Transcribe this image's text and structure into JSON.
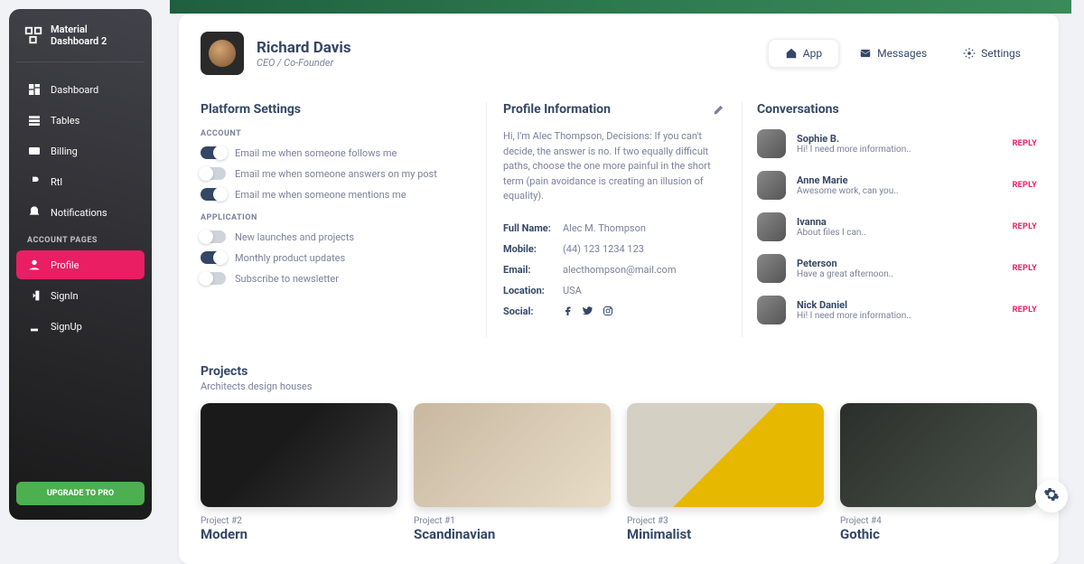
{
  "brand": "Material Dashboard 2",
  "nav": {
    "items": [
      {
        "label": "Dashboard",
        "icon": "dashboard-icon"
      },
      {
        "label": "Tables",
        "icon": "tables-icon"
      },
      {
        "label": "Billing",
        "icon": "billing-icon"
      },
      {
        "label": "Rtl",
        "icon": "rtl-icon"
      },
      {
        "label": "Notifications",
        "icon": "notifications-icon"
      }
    ],
    "section_label": "ACCOUNT PAGES",
    "account_items": [
      {
        "label": "Profile",
        "icon": "profile-icon",
        "active": true
      },
      {
        "label": "SignIn",
        "icon": "signin-icon"
      },
      {
        "label": "SignUp",
        "icon": "signup-icon"
      }
    ],
    "upgrade_label": "UPGRADE TO PRO"
  },
  "profile": {
    "name": "Richard Davis",
    "role": "CEO / Co-Founder"
  },
  "tabs": {
    "app": "App",
    "messages": "Messages",
    "settings": "Settings"
  },
  "settings": {
    "title": "Platform Settings",
    "account_label": "ACCOUNT",
    "account_toggles": [
      {
        "label": "Email me when someone follows me",
        "on": true
      },
      {
        "label": "Email me when someone answers on my post",
        "on": false
      },
      {
        "label": "Email me when someone mentions me",
        "on": true
      }
    ],
    "application_label": "APPLICATION",
    "app_toggles": [
      {
        "label": "New launches and projects",
        "on": false
      },
      {
        "label": "Monthly product updates",
        "on": true
      },
      {
        "label": "Subscribe to newsletter",
        "on": false
      }
    ]
  },
  "info": {
    "title": "Profile Information",
    "bio": "Hi, I'm Alec Thompson, Decisions: If you can't decide, the answer is no. If two equally difficult paths, choose the one more painful in the short term (pain avoidance is creating an illusion of equality).",
    "rows": {
      "fullname_key": "Full Name:",
      "fullname_val": "Alec M. Thompson",
      "mobile_key": "Mobile:",
      "mobile_val": "(44) 123 1234 123",
      "email_key": "Email:",
      "email_val": "alecthompson@mail.com",
      "location_key": "Location:",
      "location_val": "USA",
      "social_key": "Social:"
    }
  },
  "conversations": {
    "title": "Conversations",
    "reply_label": "REPLY",
    "items": [
      {
        "name": "Sophie B.",
        "msg": "Hi! I need more information.."
      },
      {
        "name": "Anne Marie",
        "msg": "Awesome work, can you.."
      },
      {
        "name": "Ivanna",
        "msg": "About files I can.."
      },
      {
        "name": "Peterson",
        "msg": "Have a great afternoon.."
      },
      {
        "name": "Nick Daniel",
        "msg": "Hi! I need more information.."
      }
    ]
  },
  "projects": {
    "title": "Projects",
    "subtitle": "Architects design houses",
    "items": [
      {
        "num": "Project #2",
        "name": "Modern"
      },
      {
        "num": "Project #1",
        "name": "Scandinavian"
      },
      {
        "num": "Project #3",
        "name": "Minimalist"
      },
      {
        "num": "Project #4",
        "name": "Gothic"
      }
    ]
  }
}
